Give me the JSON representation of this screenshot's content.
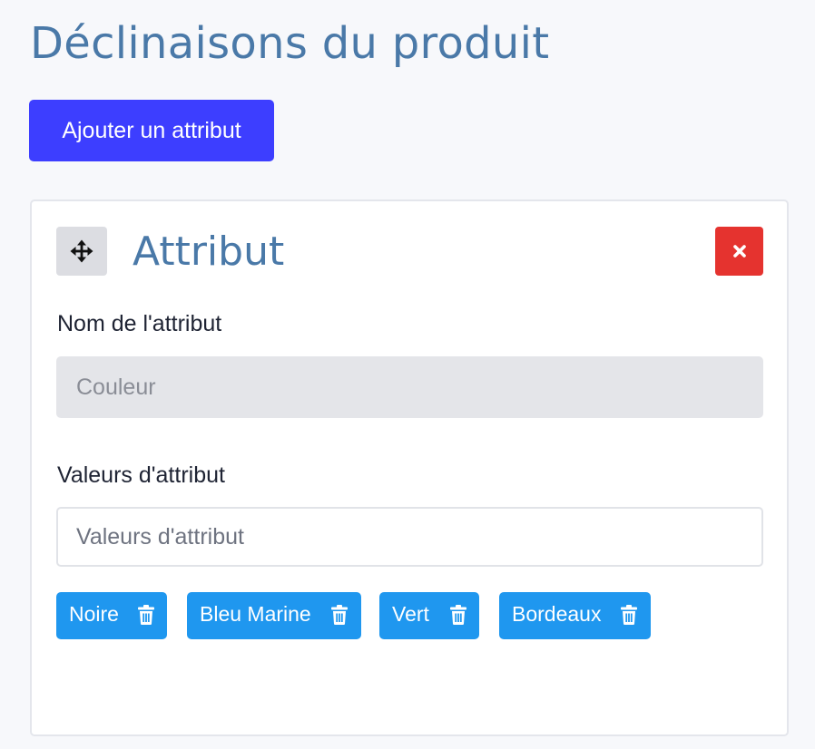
{
  "header": {
    "title": "Déclinaisons du produit",
    "add_attribute_label": "Ajouter un attribut"
  },
  "attribute_card": {
    "title": "Attribut",
    "drag_icon": "move-arrows-icon",
    "delete_icon": "close-x-icon",
    "name_field": {
      "label": "Nom de l'attribut",
      "value": "Couleur",
      "disabled": true
    },
    "values_field": {
      "label": "Valeurs d'attribut",
      "placeholder": "Valeurs d'attribut",
      "value": ""
    },
    "values": [
      {
        "label": "Noire",
        "icon": "trash-icon"
      },
      {
        "label": "Bleu Marine",
        "icon": "trash-icon"
      },
      {
        "label": "Vert",
        "icon": "trash-icon"
      },
      {
        "label": "Bordeaux",
        "icon": "trash-icon"
      }
    ]
  },
  "colors": {
    "title": "#4a79a8",
    "primary_button": "#3d3eff",
    "danger_button": "#e5332f",
    "tag": "#1f97ef",
    "background": "#f7f8fb"
  }
}
